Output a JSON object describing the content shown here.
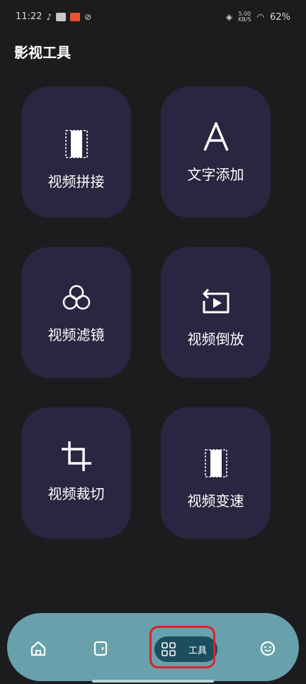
{
  "status_bar": {
    "time": "11:22",
    "net_speed_top": "5.00",
    "net_speed_unit": "KB/S",
    "battery": "62%"
  },
  "page": {
    "title": "影视工具"
  },
  "tools": [
    {
      "label": "视频拼接",
      "icon": "film-strip-icon"
    },
    {
      "label": "文字添加",
      "icon": "text-a-icon"
    },
    {
      "label": "视频滤镜",
      "icon": "filter-circles-icon"
    },
    {
      "label": "视频倒放",
      "icon": "reverse-play-icon"
    },
    {
      "label": "视频裁切",
      "icon": "crop-icon"
    },
    {
      "label": "视频变速",
      "icon": "film-strip-icon"
    }
  ],
  "bottom_nav": {
    "items": [
      {
        "icon": "home-icon"
      },
      {
        "icon": "bookmark-card-icon"
      },
      {
        "icon": "grid-icon",
        "label": "工具"
      },
      {
        "icon": "smiley-icon"
      }
    ],
    "active_index": 2
  },
  "colors": {
    "background": "#1c1c1f",
    "tile": "#2a2540",
    "nav_bar": "#68a1ab",
    "nav_active": "#1d4e5e",
    "highlight": "#e0202a"
  }
}
